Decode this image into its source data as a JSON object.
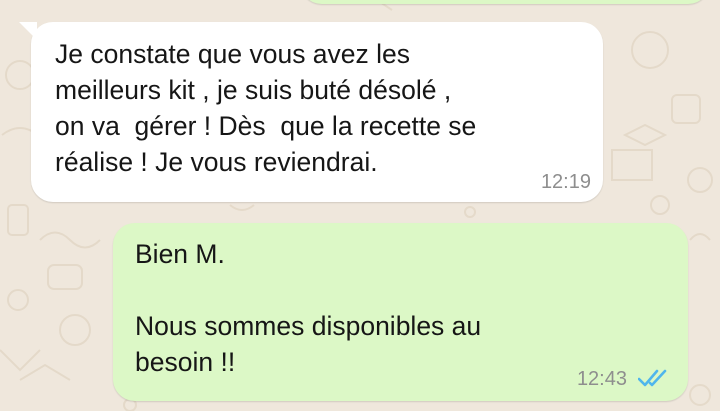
{
  "chat": {
    "messages": [
      {
        "direction": "incoming",
        "lines": [
          "Je constate que vous avez les",
          "meilleurs kit , je suis buté désolé ,",
          "on va  gérer ! Dès  que la recette se",
          "réalise ! Je vous reviendrai."
        ],
        "time": "12:19"
      },
      {
        "direction": "outgoing",
        "lines": [
          "Bien M.",
          "",
          "Nous sommes disponibles au",
          "besoin !!"
        ],
        "time": "12:43",
        "status_icon": "double-check-read-icon"
      }
    ]
  },
  "colors": {
    "background": "#efe7dc",
    "incoming_bubble": "#ffffff",
    "outgoing_bubble": "#dcf8c6",
    "read_ticks": "#4fb6ec",
    "timestamp": "#8e8e8e",
    "text": "#161616"
  }
}
